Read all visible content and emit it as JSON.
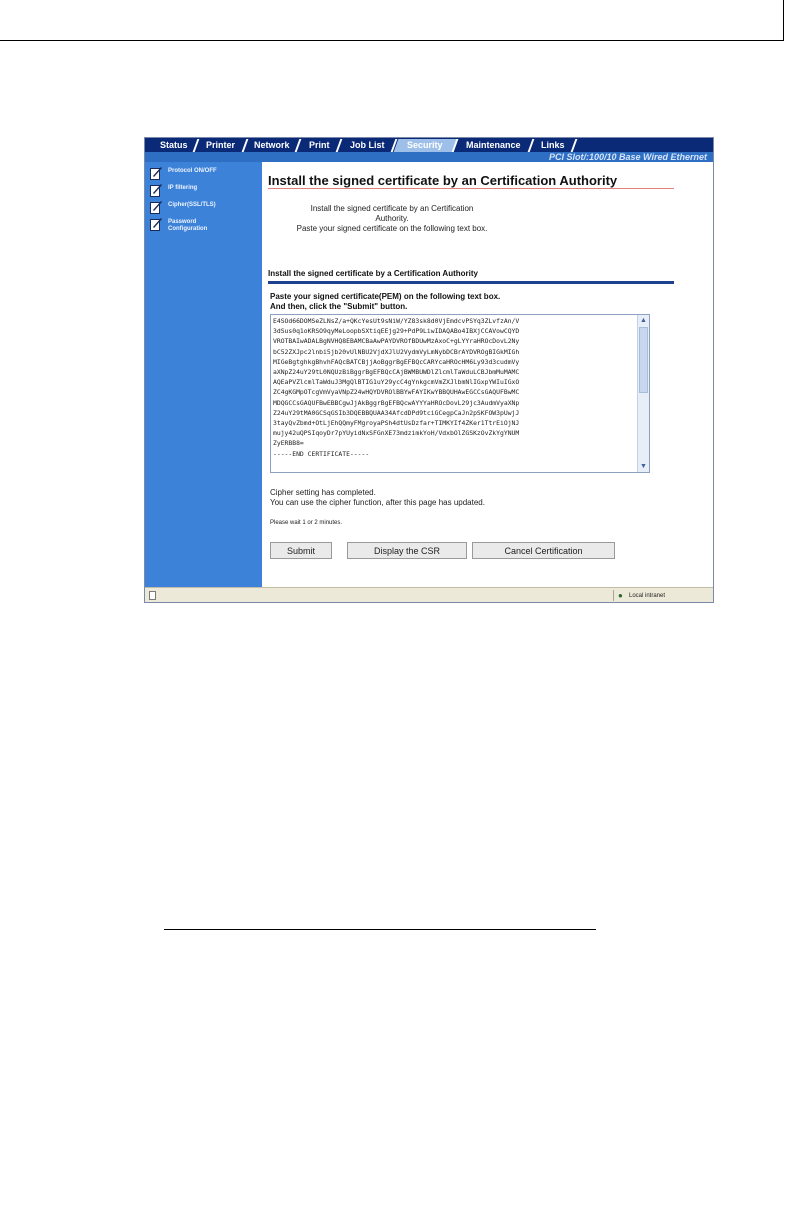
{
  "tabs": [
    {
      "label": "Status"
    },
    {
      "label": "Printer"
    },
    {
      "label": "Network"
    },
    {
      "label": "Print"
    },
    {
      "label": "Job List"
    },
    {
      "label": "Security"
    },
    {
      "label": "Maintenance"
    },
    {
      "label": "Links"
    }
  ],
  "slot_info": "PCI Slot/:100/10 Base Wired Ethernet",
  "sidebar": {
    "items": [
      {
        "label": "Protocol ON/OFF"
      },
      {
        "label": "IP filtering"
      },
      {
        "label": "Cipher(SSL/TLS)"
      },
      {
        "label": "Password Configuration"
      }
    ]
  },
  "main": {
    "title": "Install the signed certificate by an Certification Authority",
    "intro_line1": "Install the signed certificate by an Certification Authority.",
    "intro_line2": "Paste your signed certificate on the following text box.",
    "section_heading": "Install the signed certificate by a Certification Authority",
    "paste_line1": "Paste your signed certificate(PEM) on the following text box.",
    "paste_line2": "And then, click the \"Submit\" button.",
    "certificate_text": "E4SOd66DOMSeZLNsZ/a+QKcYesUt9sNiW/YZ83sk8d0VjEmdcvPSYq3ZLvfzAn/V\n3dSus0q1oKRSO9qyMeLoopbSXtiqEEjg29+PdP9LiwIDAQABo4IBXjCCAVowCQYD\nVROTBAIwADALBgNVHQ8EBAMCBaAwPAYDVROfBDUwMzAxoC+gLYYraHROcDovL2Ny\nbC52ZXJpc2lnbi5jb20vUlNBU2VjdXJlU2VydmVyLmNybDCBrAYDVROgBIGkMIGh\nMIGeBgtghkgBhvhFAQcBATCBjjAoBggrBgEFBQcCARYcaHROcHM6Ly93d3cudmVy\naXNpZ24uY29tL0NQUzBiBggrBgEFBQcCAjBWMBUWDlZlcmlTaWduLCBJbmMuMAMC\nAQEaPVZlcmlTaWduJ3MgQlBTIG1uY29ycC4gYnkgcmVmZXJlbmNlIGxpYWIuIGxO\nZC4gKGMpOTcgVmVyaVNpZ24wHQYDVROlBBYwFAYIKwYBBQUHAwEGCCsGAQUFBwMC\nMDQGCCsGAQUFBwEBBCgwJjAkBggrBgEFBQcwAYYYaHROcDovL29jc3AudmVyaXNp\nZ24uY29tMA0GCSqGSIb3DQEBBQUAA34AfcdDPd9tciGCegpCaJn2pSKFOW3pUwjJ\n3tayQvZbmd+OtLjEhQQmyFMgroyaPSh4dtUsDzfar+TIMKYIf4ZKer1TtrEiOjNJ\nmujy42uQPSIqoyDr7pYUyidNxSFGnXE73mdzimkYoH/VdxbOlZGSKzOvZkYgYNUM\nZyERBB8=\n-----END CERTIFICATE-----",
    "status_line1": "Cipher setting has completed.",
    "status_line2": "You can use the cipher function, after this page has updated.",
    "status_wait": "Please wait 1 or 2 minutes.",
    "buttons": {
      "submit": "Submit",
      "display_csr": "Display the CSR",
      "cancel": "Cancel Certification"
    }
  },
  "statusbar": {
    "zone": "Local intranet"
  }
}
